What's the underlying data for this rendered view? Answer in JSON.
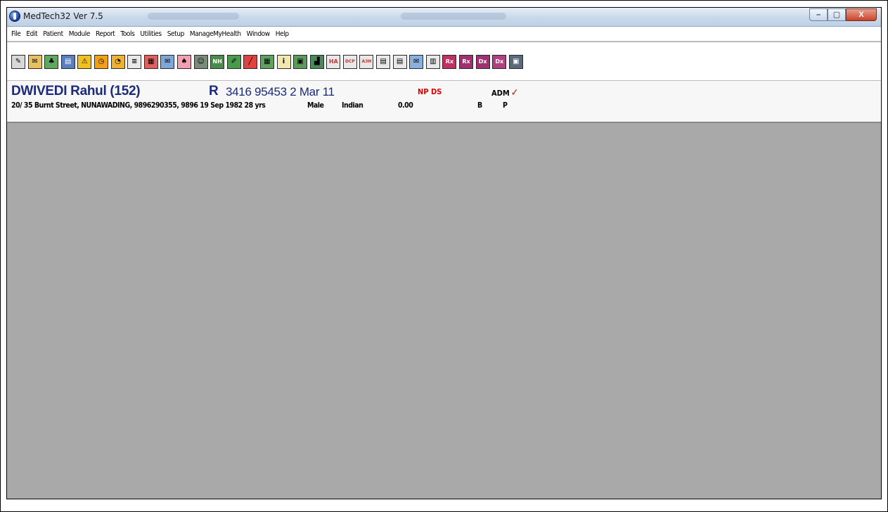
{
  "window": {
    "title": "MedTech32  Ver 7.5",
    "controls": {
      "minimize": "–",
      "maximize": "▢",
      "close": "X"
    }
  },
  "menu": {
    "items": [
      "File",
      "Edit",
      "Patient",
      "Module",
      "Report",
      "Tools",
      "Utilities",
      "Setup",
      "ManageMyHealth",
      "Window",
      "Help"
    ]
  },
  "toolbar": {
    "icons": [
      {
        "name": "patient-register-icon",
        "glyph": "✎",
        "bg": "#d8d8d8"
      },
      {
        "name": "inbox-icon",
        "glyph": "✉",
        "bg": "#e8c060"
      },
      {
        "name": "family-tree-icon",
        "glyph": "♣",
        "bg": "#5fa85f"
      },
      {
        "name": "consultation-icon",
        "glyph": "▤",
        "bg": "#5a7fc0"
      },
      {
        "name": "alert-icon",
        "glyph": "⚠",
        "bg": "#f0c020"
      },
      {
        "name": "appointment-clock-icon",
        "glyph": "◷",
        "bg": "#f2a018"
      },
      {
        "name": "recall-icon",
        "glyph": "◔",
        "bg": "#f0b030"
      },
      {
        "name": "notes-icon",
        "glyph": "≡",
        "bg": "#e8e8e8"
      },
      {
        "name": "document-icon",
        "glyph": "▦",
        "bg": "#e06060"
      },
      {
        "name": "mail-icon",
        "glyph": "✉",
        "bg": "#7fa6d8"
      },
      {
        "name": "pig-icon",
        "glyph": "♠",
        "bg": "#f0a0b0"
      },
      {
        "name": "doctor-icon",
        "glyph": "☺",
        "bg": "#7a8c7a"
      },
      {
        "name": "nhi-icon",
        "glyph": "NH",
        "bg": "#4a8a4a"
      },
      {
        "name": "pencil-icon",
        "glyph": "✐",
        "bg": "#4a9a4a"
      },
      {
        "name": "pen-icon",
        "glyph": "╱",
        "bg": "#e04040"
      },
      {
        "name": "calculator-icon",
        "glyph": "▦",
        "bg": "#60a060"
      },
      {
        "name": "info-icon",
        "glyph": "i",
        "bg": "#f0e8b0"
      },
      {
        "name": "computer-icon",
        "glyph": "▣",
        "bg": "#5a9a5a"
      },
      {
        "name": "bar-chart-icon",
        "glyph": "▟",
        "bg": "#4a8a5a"
      },
      {
        "name": "ha-form-icon",
        "glyph": "HA",
        "bg": "#e8e8e8",
        "fg": "#d03030"
      },
      {
        "name": "dcp-form-icon",
        "glyph": "DCP",
        "bg": "#e8e8e8",
        "fg": "#d03030"
      },
      {
        "name": "a3h-form-icon",
        "glyph": "A3H",
        "bg": "#e8e8e8",
        "fg": "#d03030"
      },
      {
        "name": "form-icon",
        "glyph": "▤",
        "bg": "#e8e8e8"
      },
      {
        "name": "form-list-icon",
        "glyph": "▤",
        "bg": "#e8e8e8"
      },
      {
        "name": "envelope-icon",
        "glyph": "✉",
        "bg": "#8ab0e0"
      },
      {
        "name": "letter-icon",
        "glyph": "▥",
        "bg": "#e8e8e8"
      },
      {
        "name": "rx-icon",
        "glyph": "Rx",
        "bg": "#c03060"
      },
      {
        "name": "rx-repeat-icon",
        "glyph": "Rx",
        "bg": "#a03070"
      },
      {
        "name": "dx-icon",
        "glyph": "Dx",
        "bg": "#a03070"
      },
      {
        "name": "dx-history-icon",
        "glyph": "Dx",
        "bg": "#b04080"
      },
      {
        "name": "save-disk-icon",
        "glyph": "▣",
        "bg": "#5a6a7a"
      }
    ]
  },
  "patient": {
    "name": "DWIVEDI Rahul (152)",
    "r_label": "R",
    "nhi_info": "3416 95453 2  Mar 11",
    "flags": "NP DS",
    "adm": "ADM",
    "adm_check": "✓",
    "address": "20/ 35 Burnt Street, NUNAWADING, 9896290355, 9896 19 Sep 1982 28 yrs",
    "gender": "Male",
    "ethnicity": "Indian",
    "balance": "0.00",
    "code_b": "B",
    "code_p": "P"
  },
  "colors": {
    "workspace": "#a9a9a9",
    "patient_name": "#1b2a7a",
    "flag_red": "#e00000"
  }
}
